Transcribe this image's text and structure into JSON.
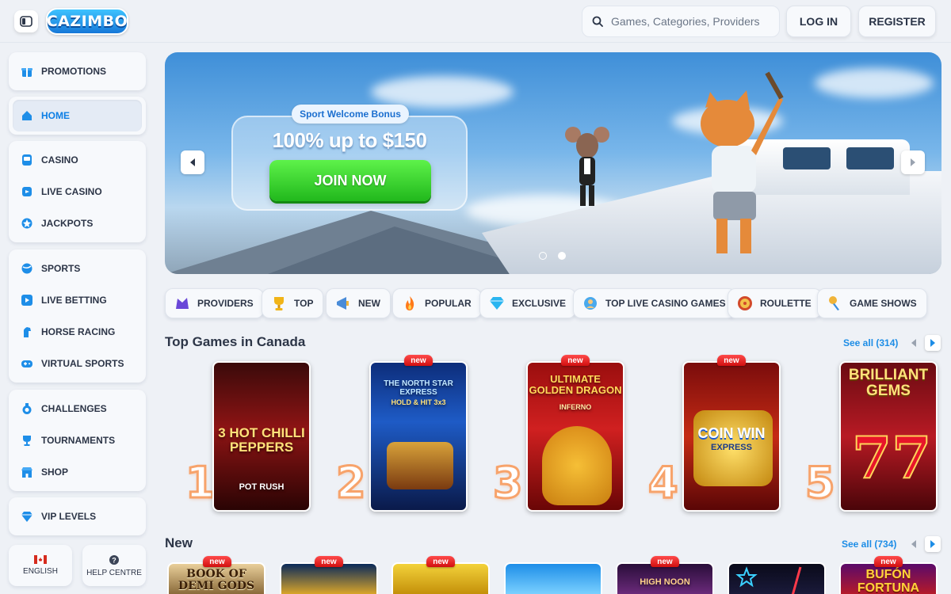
{
  "brand": {
    "logo": "CAZIMBO"
  },
  "header": {
    "search_placeholder": "Games, Categories, Providers",
    "login": "LOG IN",
    "register": "REGISTER"
  },
  "sidebar": {
    "promotions": "PROMOTIONS",
    "home": "HOME",
    "casino": "CASINO",
    "live_casino": "LIVE CASINO",
    "jackpots": "JACKPOTS",
    "sports": "SPORTS",
    "live_betting": "LIVE BETTING",
    "horse_racing": "HORSE RACING",
    "virtual_sports": "VIRTUAL SPORTS",
    "challenges": "CHALLENGES",
    "tournaments": "TOURNAMENTS",
    "shop": "SHOP",
    "vip_levels": "VIP LEVELS",
    "language": "ENGLISH",
    "help": "HELP CENTRE"
  },
  "hero": {
    "tag": "Sport Welcome Bonus",
    "title": "100% up to $150",
    "cta": "JOIN NOW",
    "active_slide": 2,
    "slide_count": 2
  },
  "categories": {
    "providers": "PROVIDERS",
    "top": "TOP",
    "new": "NEW",
    "popular": "POPULAR",
    "exclusive": "EXCLUSIVE",
    "top_live": "TOP LIVE CASINO GAMES",
    "roulette": "ROULETTE",
    "game_shows": "GAME SHOWS"
  },
  "top_games": {
    "title": "Top Games in Canada",
    "see_all": "See all (314)",
    "games": [
      {
        "rank": "1",
        "name": "3 HOT CHILLI PEPPERS",
        "sub": "POT RUSH",
        "new": false
      },
      {
        "rank": "2",
        "name": "THE NORTH STAR EXPRESS",
        "sub": "HOLD & HIT 3x3",
        "new": true
      },
      {
        "rank": "3",
        "name": "ULTIMATE GOLDEN DRAGON",
        "sub": "INFERNO",
        "new": true
      },
      {
        "rank": "4",
        "name": "COIN WIN",
        "sub": "EXPRESS",
        "new": true
      },
      {
        "rank": "5",
        "name": "BRILLIANT GEMS",
        "sub": "",
        "new": false
      }
    ]
  },
  "new_games": {
    "title": "New",
    "see_all": "See all (734)",
    "badge": "new",
    "games": [
      {
        "name": "BOOK OF DEMI GODS"
      },
      {
        "name": ""
      },
      {
        "name": ""
      },
      {
        "name": ""
      },
      {
        "name": "HIGH NOON"
      },
      {
        "name": ""
      },
      {
        "name": "BUFÓN FORTUNA"
      }
    ]
  },
  "colors": {
    "accent": "#0d7fe5",
    "join_green": "#21b81c",
    "rank_orange": "#f7a36b",
    "badge_red": "#d10f0f"
  }
}
